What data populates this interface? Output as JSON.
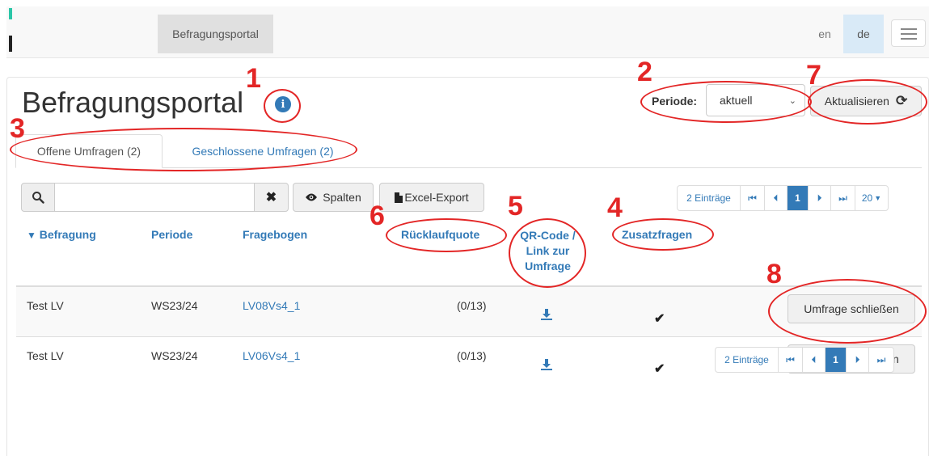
{
  "navbar": {
    "portal_label": "Befragungsportal",
    "lang_en": "en",
    "lang_de": "de"
  },
  "page": {
    "title": "Befragungsportal",
    "info_icon": "info-circle-icon"
  },
  "period": {
    "label": "Periode:",
    "selected": "aktuell"
  },
  "refresh_label": "Aktualisieren",
  "tabs": [
    {
      "label": "Offene Umfragen (2)",
      "active": true
    },
    {
      "label": "Geschlossene Umfragen (2)",
      "active": false
    }
  ],
  "toolbar": {
    "search_value": "",
    "columns_label": "Spalten",
    "excel_label": "Excel-Export"
  },
  "pagination": {
    "entries_label": "2 Einträge",
    "current_page": "1",
    "page_size": "20"
  },
  "table": {
    "sort_indicator": "▼",
    "headers": {
      "befragung": "Befragung",
      "periode": "Periode",
      "fragebogen": "Fragebogen",
      "ruecklaufquote": "Rücklaufquote",
      "qr_line1": "QR-Code /",
      "qr_line2": "Link zur",
      "qr_line3": "Umfrage",
      "zusatzfragen": "Zusatzfragen"
    },
    "rows": [
      {
        "befragung": "Test LV",
        "periode": "WS23/24",
        "fragebogen": "LV08Vs4_1",
        "ruecklauf": "(0/13)",
        "action": "Umfrage schließen"
      },
      {
        "befragung": "Test LV",
        "periode": "WS23/24",
        "fragebogen": "LV06Vs4_1",
        "ruecklauf": "(0/13)",
        "action": "Umfrage schließen"
      }
    ]
  },
  "annotations": [
    "1",
    "2",
    "3",
    "4",
    "5",
    "6",
    "7",
    "8"
  ],
  "colors": {
    "annotation": "#e32626",
    "link": "#337ab7",
    "accent": "#2bc6a8"
  }
}
